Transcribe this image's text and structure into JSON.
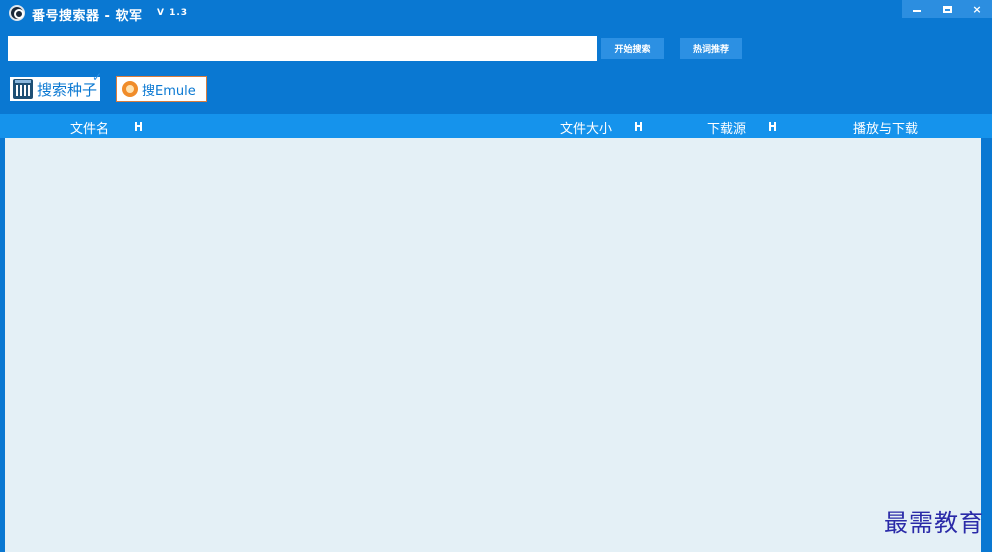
{
  "window": {
    "title": "番号搜索器 - 软军",
    "version": "V 1.3",
    "controls": {
      "minimize_icon": "minimize-icon",
      "maximize_icon": "maximize-icon",
      "close_label": "×"
    }
  },
  "search": {
    "value": "",
    "placeholder": "",
    "start_button": "开始搜索",
    "hot_button": "热词推荐"
  },
  "sources": {
    "seed": {
      "label": "搜索种子",
      "icon": "seed-icon"
    },
    "emule": {
      "label": "搜Emule",
      "icon": "emule-icon"
    }
  },
  "table": {
    "columns": [
      {
        "label": "文件名",
        "sortable": true
      },
      {
        "label": "文件大小",
        "sortable": true
      },
      {
        "label": "下载源",
        "sortable": true
      },
      {
        "label": "播放与下载",
        "sortable": false
      }
    ],
    "rows": []
  },
  "watermark": "最需教育",
  "colors": {
    "window_bg": "#0a78d2",
    "header_bg": "#1593ec",
    "button_bg": "#2c90e3",
    "results_bg": "#e4f0f6",
    "watermark": "#2a2aa8"
  }
}
